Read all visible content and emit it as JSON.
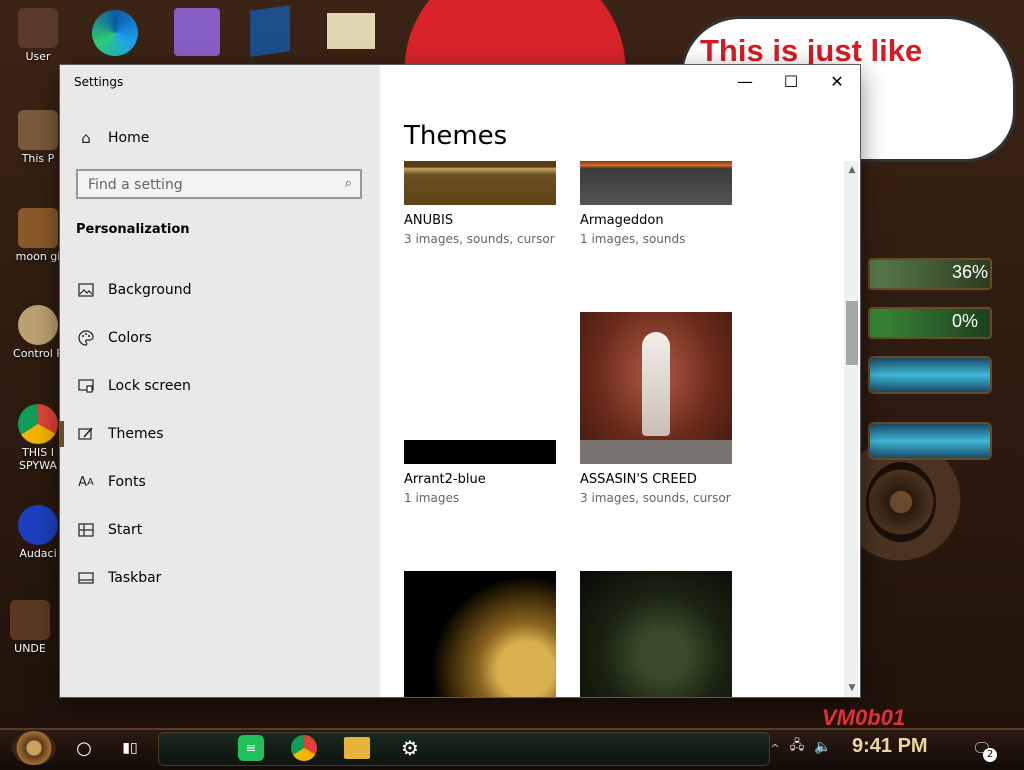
{
  "desktop": {
    "icons": [
      {
        "label": "User",
        "name": "desktop-icon-user"
      },
      {
        "label": "This P",
        "name": "desktop-icon-this-pc"
      },
      {
        "label": "moon gi",
        "name": "desktop-icon-moon"
      },
      {
        "label": "Control P",
        "name": "desktop-icon-control-panel"
      },
      {
        "label": "THIS I SPYWA",
        "name": "desktop-icon-chrome"
      },
      {
        "label": "Audaci",
        "name": "desktop-icon-audacity"
      },
      {
        "label": "UNDE",
        "name": "desktop-icon-under"
      }
    ],
    "bubble_text": "This is just like\n well's",
    "gauges": [
      {
        "label": "36%",
        "value": 36
      },
      {
        "label": "0%",
        "value": 0
      }
    ]
  },
  "window": {
    "app_title": "Settings",
    "controls": {
      "minimize": "—",
      "maximize": "☐",
      "close": "✕"
    },
    "sidebar": {
      "home": "Home",
      "search_placeholder": "Find a setting",
      "section": "Personalization",
      "items": [
        {
          "label": "Background",
          "icon": "image-icon"
        },
        {
          "label": "Colors",
          "icon": "palette-icon"
        },
        {
          "label": "Lock screen",
          "icon": "lock-screen-icon"
        },
        {
          "label": "Themes",
          "icon": "brush-icon"
        },
        {
          "label": "Fonts",
          "icon": "fonts-icon"
        },
        {
          "label": "Start",
          "icon": "start-icon"
        },
        {
          "label": "Taskbar",
          "icon": "taskbar-icon"
        }
      ],
      "active": "Themes"
    },
    "page_title": "Themes",
    "themes": [
      {
        "name": "ANUBIS",
        "meta": "3 images, sounds, cursor"
      },
      {
        "name": "Armageddon",
        "meta": "1 images, sounds"
      },
      {
        "name": "Arrant2-blue",
        "meta": "1 images"
      },
      {
        "name": "ASSASIN'S CREED",
        "meta": "3 images, sounds, cursor"
      },
      {
        "name": "",
        "meta": ""
      },
      {
        "name": "",
        "meta": ""
      }
    ]
  },
  "taskbar": {
    "clock": "9:41 PM",
    "notification_count": "2",
    "watermark": "VM0b01"
  }
}
